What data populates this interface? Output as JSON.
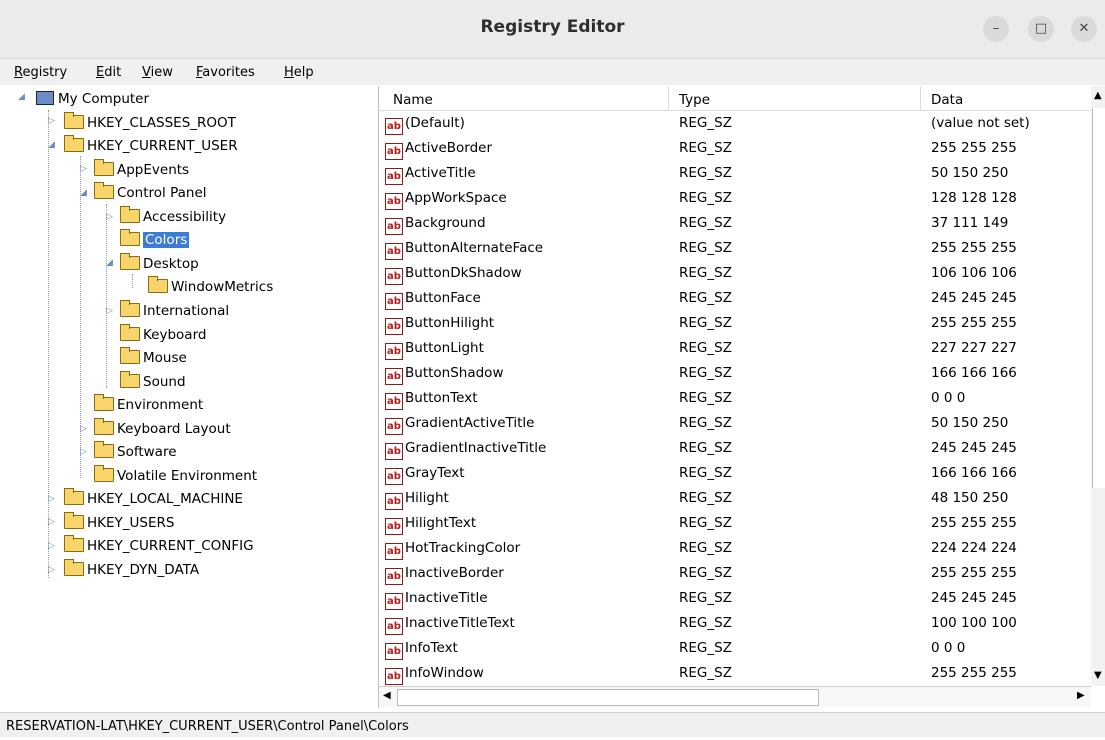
{
  "window": {
    "title": "Registry Editor",
    "minimize_icon": "minimize-icon",
    "maximize_icon": "maximize-icon",
    "close_icon": "close-icon"
  },
  "menu": {
    "items": [
      "Registry",
      "Edit",
      "View",
      "Favorites",
      "Help"
    ]
  },
  "tree": {
    "root": "My Computer",
    "nodes": [
      {
        "label": "HKEY_CLASSES_ROOT"
      },
      {
        "label": "HKEY_CURRENT_USER"
      },
      {
        "label": "AppEvents"
      },
      {
        "label": "Control Panel"
      },
      {
        "label": "Accessibility"
      },
      {
        "label": "Colors"
      },
      {
        "label": "Desktop"
      },
      {
        "label": "WindowMetrics"
      },
      {
        "label": "International"
      },
      {
        "label": "Keyboard"
      },
      {
        "label": "Mouse"
      },
      {
        "label": "Sound"
      },
      {
        "label": "Environment"
      },
      {
        "label": "Keyboard Layout"
      },
      {
        "label": "Software"
      },
      {
        "label": "Volatile Environment"
      },
      {
        "label": "HKEY_LOCAL_MACHINE"
      },
      {
        "label": "HKEY_USERS"
      },
      {
        "label": "HKEY_CURRENT_CONFIG"
      },
      {
        "label": "HKEY_DYN_DATA"
      }
    ],
    "selected": "Colors"
  },
  "values": {
    "columns": [
      "Name",
      "Type",
      "Data"
    ],
    "icon": "string-value-icon",
    "icon_text": "ab",
    "rows": [
      {
        "name": "(Default)",
        "type": "REG_SZ",
        "data": "(value not set)"
      },
      {
        "name": "ActiveBorder",
        "type": "REG_SZ",
        "data": "255 255 255"
      },
      {
        "name": "ActiveTitle",
        "type": "REG_SZ",
        "data": "50 150 250"
      },
      {
        "name": "AppWorkSpace",
        "type": "REG_SZ",
        "data": "128 128 128"
      },
      {
        "name": "Background",
        "type": "REG_SZ",
        "data": "37 111 149"
      },
      {
        "name": "ButtonAlternateFace",
        "type": "REG_SZ",
        "data": "255 255 255"
      },
      {
        "name": "ButtonDkShadow",
        "type": "REG_SZ",
        "data": "106 106 106"
      },
      {
        "name": "ButtonFace",
        "type": "REG_SZ",
        "data": "245 245 245"
      },
      {
        "name": "ButtonHilight",
        "type": "REG_SZ",
        "data": "255 255 255"
      },
      {
        "name": "ButtonLight",
        "type": "REG_SZ",
        "data": "227 227 227"
      },
      {
        "name": "ButtonShadow",
        "type": "REG_SZ",
        "data": "166 166 166"
      },
      {
        "name": "ButtonText",
        "type": "REG_SZ",
        "data": "0 0 0"
      },
      {
        "name": "GradientActiveTitle",
        "type": "REG_SZ",
        "data": "50 150 250"
      },
      {
        "name": "GradientInactiveTitle",
        "type": "REG_SZ",
        "data": "245 245 245"
      },
      {
        "name": "GrayText",
        "type": "REG_SZ",
        "data": "166 166 166"
      },
      {
        "name": "Hilight",
        "type": "REG_SZ",
        "data": "48 150 250"
      },
      {
        "name": "HilightText",
        "type": "REG_SZ",
        "data": "255 255 255"
      },
      {
        "name": "HotTrackingColor",
        "type": "REG_SZ",
        "data": "224 224 224"
      },
      {
        "name": "InactiveBorder",
        "type": "REG_SZ",
        "data": "255 255 255"
      },
      {
        "name": "InactiveTitle",
        "type": "REG_SZ",
        "data": "245 245 245"
      },
      {
        "name": "InactiveTitleText",
        "type": "REG_SZ",
        "data": "100 100 100"
      },
      {
        "name": "InfoText",
        "type": "REG_SZ",
        "data": "0 0 0"
      },
      {
        "name": "InfoWindow",
        "type": "REG_SZ",
        "data": "255 255 255"
      }
    ]
  },
  "status": {
    "path": "RESERVATION-LAT\\HKEY_CURRENT_USER\\Control Panel\\Colors"
  },
  "colors": {
    "selection": "#3d7bd6",
    "folder": "#f7d56a",
    "string_icon": "#b01b1b"
  }
}
